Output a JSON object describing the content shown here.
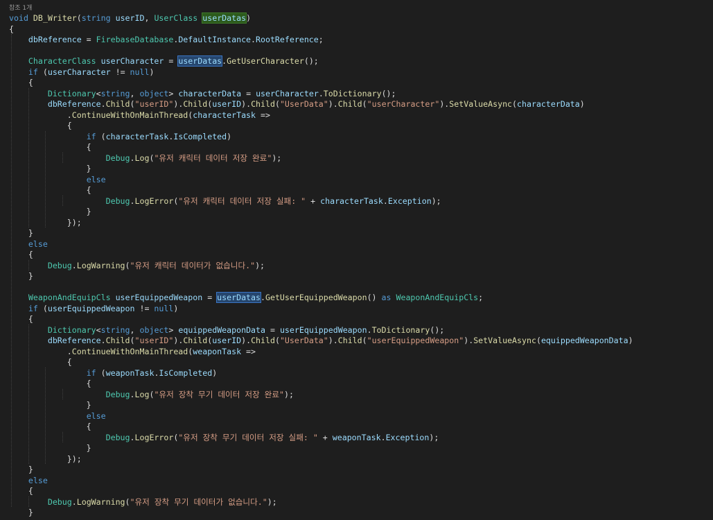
{
  "editor": {
    "codelens": "참조 1개",
    "colors": {
      "background": "#1e1e1e",
      "keyword": "#569cd6",
      "type": "#4ec9b0",
      "method": "#dcdcaa",
      "string": "#d69d85",
      "identifier": "#9cdcfe",
      "default": "#dcdcdc",
      "definition_highlight": "#2c5a1c",
      "reference_highlight": "#26466e"
    },
    "lines": [
      [
        [
          "kw",
          "void"
        ],
        [
          "tx",
          " "
        ],
        [
          "mt",
          "DB_Writer"
        ],
        [
          "tx",
          "("
        ],
        [
          "kw",
          "string"
        ],
        [
          "tx",
          " "
        ],
        [
          "pm",
          "userID"
        ],
        [
          "tx",
          ", "
        ],
        [
          "ty",
          "UserClass"
        ],
        [
          "tx",
          " "
        ],
        [
          "pm hl-def",
          "userDatas"
        ],
        [
          "tx",
          ")"
        ]
      ],
      [
        [
          "tx",
          "{"
        ]
      ],
      [
        [
          "tx",
          "    "
        ],
        [
          "pr",
          "dbReference"
        ],
        [
          "tx",
          " = "
        ],
        [
          "ty",
          "FirebaseDatabase"
        ],
        [
          "tx",
          "."
        ],
        [
          "pr",
          "DefaultInstance"
        ],
        [
          "tx",
          "."
        ],
        [
          "pr",
          "RootReference"
        ],
        [
          "tx",
          ";"
        ]
      ],
      [],
      [
        [
          "tx",
          "    "
        ],
        [
          "ty",
          "CharacterClass"
        ],
        [
          "tx",
          " "
        ],
        [
          "pm",
          "userCharacter"
        ],
        [
          "tx",
          " = "
        ],
        [
          "pm hl-ref",
          "userDatas"
        ],
        [
          "tx",
          "."
        ],
        [
          "mt",
          "GetUserCharacter"
        ],
        [
          "tx",
          "();"
        ]
      ],
      [
        [
          "tx",
          "    "
        ],
        [
          "kw",
          "if"
        ],
        [
          "tx",
          " ("
        ],
        [
          "pm",
          "userCharacter"
        ],
        [
          "tx",
          " != "
        ],
        [
          "kw",
          "null"
        ],
        [
          "tx",
          ")"
        ]
      ],
      [
        [
          "tx",
          "    {"
        ]
      ],
      [
        [
          "tx",
          "        "
        ],
        [
          "ty",
          "Dictionary"
        ],
        [
          "tx",
          "<"
        ],
        [
          "kw",
          "string"
        ],
        [
          "tx",
          ", "
        ],
        [
          "kw",
          "object"
        ],
        [
          "tx",
          "> "
        ],
        [
          "pm",
          "characterData"
        ],
        [
          "tx",
          " = "
        ],
        [
          "pm",
          "userCharacter"
        ],
        [
          "tx",
          "."
        ],
        [
          "mt",
          "ToDictionary"
        ],
        [
          "tx",
          "();"
        ]
      ],
      [
        [
          "tx",
          "        "
        ],
        [
          "pr",
          "dbReference"
        ],
        [
          "tx",
          "."
        ],
        [
          "mt",
          "Child"
        ],
        [
          "tx",
          "("
        ],
        [
          "st",
          "\"userID\""
        ],
        [
          "tx",
          ")."
        ],
        [
          "mt",
          "Child"
        ],
        [
          "tx",
          "("
        ],
        [
          "pm",
          "userID"
        ],
        [
          "tx",
          ")."
        ],
        [
          "mt",
          "Child"
        ],
        [
          "tx",
          "("
        ],
        [
          "st",
          "\"UserData\""
        ],
        [
          "tx",
          ")."
        ],
        [
          "mt",
          "Child"
        ],
        [
          "tx",
          "("
        ],
        [
          "st",
          "\"userCharacter\""
        ],
        [
          "tx",
          ")."
        ],
        [
          "mt",
          "SetValueAsync"
        ],
        [
          "tx",
          "("
        ],
        [
          "pm",
          "characterData"
        ],
        [
          "tx",
          ")"
        ]
      ],
      [
        [
          "tx",
          "            ."
        ],
        [
          "mt",
          "ContinueWithOnMainThread"
        ],
        [
          "tx",
          "("
        ],
        [
          "pm",
          "characterTask"
        ],
        [
          "tx",
          " =>"
        ]
      ],
      [
        [
          "tx",
          "            {"
        ]
      ],
      [
        [
          "tx",
          "                "
        ],
        [
          "kw",
          "if"
        ],
        [
          "tx",
          " ("
        ],
        [
          "pm",
          "characterTask"
        ],
        [
          "tx",
          "."
        ],
        [
          "pr",
          "IsCompleted"
        ],
        [
          "tx",
          ")"
        ]
      ],
      [
        [
          "tx",
          "                {"
        ]
      ],
      [
        [
          "tx",
          "                    "
        ],
        [
          "ty",
          "Debug"
        ],
        [
          "tx",
          "."
        ],
        [
          "mt",
          "Log"
        ],
        [
          "tx",
          "("
        ],
        [
          "st",
          "\"유저 캐릭터 데이터 저장 완료\""
        ],
        [
          "tx",
          ");"
        ]
      ],
      [
        [
          "tx",
          "                }"
        ]
      ],
      [
        [
          "tx",
          "                "
        ],
        [
          "kw",
          "else"
        ]
      ],
      [
        [
          "tx",
          "                {"
        ]
      ],
      [
        [
          "tx",
          "                    "
        ],
        [
          "ty",
          "Debug"
        ],
        [
          "tx",
          "."
        ],
        [
          "mt",
          "LogError"
        ],
        [
          "tx",
          "("
        ],
        [
          "st",
          "\"유저 캐릭터 데이터 저장 실패: \""
        ],
        [
          "tx",
          " + "
        ],
        [
          "pm",
          "characterTask"
        ],
        [
          "tx",
          "."
        ],
        [
          "pr",
          "Exception"
        ],
        [
          "tx",
          ");"
        ]
      ],
      [
        [
          "tx",
          "                }"
        ]
      ],
      [
        [
          "tx",
          "            });"
        ]
      ],
      [
        [
          "tx",
          "    }"
        ]
      ],
      [
        [
          "tx",
          "    "
        ],
        [
          "kw",
          "else"
        ]
      ],
      [
        [
          "tx",
          "    {"
        ]
      ],
      [
        [
          "tx",
          "        "
        ],
        [
          "ty",
          "Debug"
        ],
        [
          "tx",
          "."
        ],
        [
          "mt",
          "LogWarning"
        ],
        [
          "tx",
          "("
        ],
        [
          "st",
          "\"유저 캐릭터 데이터가 없습니다.\""
        ],
        [
          "tx",
          ");"
        ]
      ],
      [
        [
          "tx",
          "    }"
        ]
      ],
      [],
      [
        [
          "tx",
          "    "
        ],
        [
          "ty",
          "WeaponAndEquipCls"
        ],
        [
          "tx",
          " "
        ],
        [
          "pm",
          "userEquippedWeapon"
        ],
        [
          "tx",
          " = "
        ],
        [
          "pm hl-ref",
          "userDatas"
        ],
        [
          "tx",
          "."
        ],
        [
          "mt",
          "GetUserEquippedWeapon"
        ],
        [
          "tx",
          "() "
        ],
        [
          "kw",
          "as"
        ],
        [
          "tx",
          " "
        ],
        [
          "ty",
          "WeaponAndEquipCls"
        ],
        [
          "tx",
          ";"
        ]
      ],
      [
        [
          "tx",
          "    "
        ],
        [
          "kw",
          "if"
        ],
        [
          "tx",
          " ("
        ],
        [
          "pm",
          "userEquippedWeapon"
        ],
        [
          "tx",
          " != "
        ],
        [
          "kw",
          "null"
        ],
        [
          "tx",
          ")"
        ]
      ],
      [
        [
          "tx",
          "    {"
        ]
      ],
      [
        [
          "tx",
          "        "
        ],
        [
          "ty",
          "Dictionary"
        ],
        [
          "tx",
          "<"
        ],
        [
          "kw",
          "string"
        ],
        [
          "tx",
          ", "
        ],
        [
          "kw",
          "object"
        ],
        [
          "tx",
          "> "
        ],
        [
          "pm",
          "equippedWeaponData"
        ],
        [
          "tx",
          " = "
        ],
        [
          "pm",
          "userEquippedWeapon"
        ],
        [
          "tx",
          "."
        ],
        [
          "mt",
          "ToDictionary"
        ],
        [
          "tx",
          "();"
        ]
      ],
      [
        [
          "tx",
          "        "
        ],
        [
          "pr",
          "dbReference"
        ],
        [
          "tx",
          "."
        ],
        [
          "mt",
          "Child"
        ],
        [
          "tx",
          "("
        ],
        [
          "st",
          "\"userID\""
        ],
        [
          "tx",
          ")."
        ],
        [
          "mt",
          "Child"
        ],
        [
          "tx",
          "("
        ],
        [
          "pm",
          "userID"
        ],
        [
          "tx",
          ")."
        ],
        [
          "mt",
          "Child"
        ],
        [
          "tx",
          "("
        ],
        [
          "st",
          "\"UserData\""
        ],
        [
          "tx",
          ")."
        ],
        [
          "mt",
          "Child"
        ],
        [
          "tx",
          "("
        ],
        [
          "st",
          "\"userEquippedWeapon\""
        ],
        [
          "tx",
          ")."
        ],
        [
          "mt",
          "SetValueAsync"
        ],
        [
          "tx",
          "("
        ],
        [
          "pm",
          "equippedWeaponData"
        ],
        [
          "tx",
          ")"
        ]
      ],
      [
        [
          "tx",
          "            ."
        ],
        [
          "mt",
          "ContinueWithOnMainThread"
        ],
        [
          "tx",
          "("
        ],
        [
          "pm",
          "weaponTask"
        ],
        [
          "tx",
          " =>"
        ]
      ],
      [
        [
          "tx",
          "            {"
        ]
      ],
      [
        [
          "tx",
          "                "
        ],
        [
          "kw",
          "if"
        ],
        [
          "tx",
          " ("
        ],
        [
          "pm",
          "weaponTask"
        ],
        [
          "tx",
          "."
        ],
        [
          "pr",
          "IsCompleted"
        ],
        [
          "tx",
          ")"
        ]
      ],
      [
        [
          "tx",
          "                {"
        ]
      ],
      [
        [
          "tx",
          "                    "
        ],
        [
          "ty",
          "Debug"
        ],
        [
          "tx",
          "."
        ],
        [
          "mt",
          "Log"
        ],
        [
          "tx",
          "("
        ],
        [
          "st",
          "\"유저 장착 무기 데이터 저장 완료\""
        ],
        [
          "tx",
          ");"
        ]
      ],
      [
        [
          "tx",
          "                }"
        ]
      ],
      [
        [
          "tx",
          "                "
        ],
        [
          "kw",
          "else"
        ]
      ],
      [
        [
          "tx",
          "                {"
        ]
      ],
      [
        [
          "tx",
          "                    "
        ],
        [
          "ty",
          "Debug"
        ],
        [
          "tx",
          "."
        ],
        [
          "mt",
          "LogError"
        ],
        [
          "tx",
          "("
        ],
        [
          "st",
          "\"유저 장착 무기 데이터 저장 실패: \""
        ],
        [
          "tx",
          " + "
        ],
        [
          "pm",
          "weaponTask"
        ],
        [
          "tx",
          "."
        ],
        [
          "pr",
          "Exception"
        ],
        [
          "tx",
          ");"
        ]
      ],
      [
        [
          "tx",
          "                }"
        ]
      ],
      [
        [
          "tx",
          "            });"
        ]
      ],
      [
        [
          "tx",
          "    }"
        ]
      ],
      [
        [
          "tx",
          "    "
        ],
        [
          "kw",
          "else"
        ]
      ],
      [
        [
          "tx",
          "    {"
        ]
      ],
      [
        [
          "tx",
          "        "
        ],
        [
          "ty",
          "Debug"
        ],
        [
          "tx",
          "."
        ],
        [
          "mt",
          "LogWarning"
        ],
        [
          "tx",
          "("
        ],
        [
          "st",
          "\"유저 장착 무기 데이터가 없습니다.\""
        ],
        [
          "tx",
          ");"
        ]
      ],
      [
        [
          "tx",
          "    }"
        ]
      ]
    ]
  }
}
